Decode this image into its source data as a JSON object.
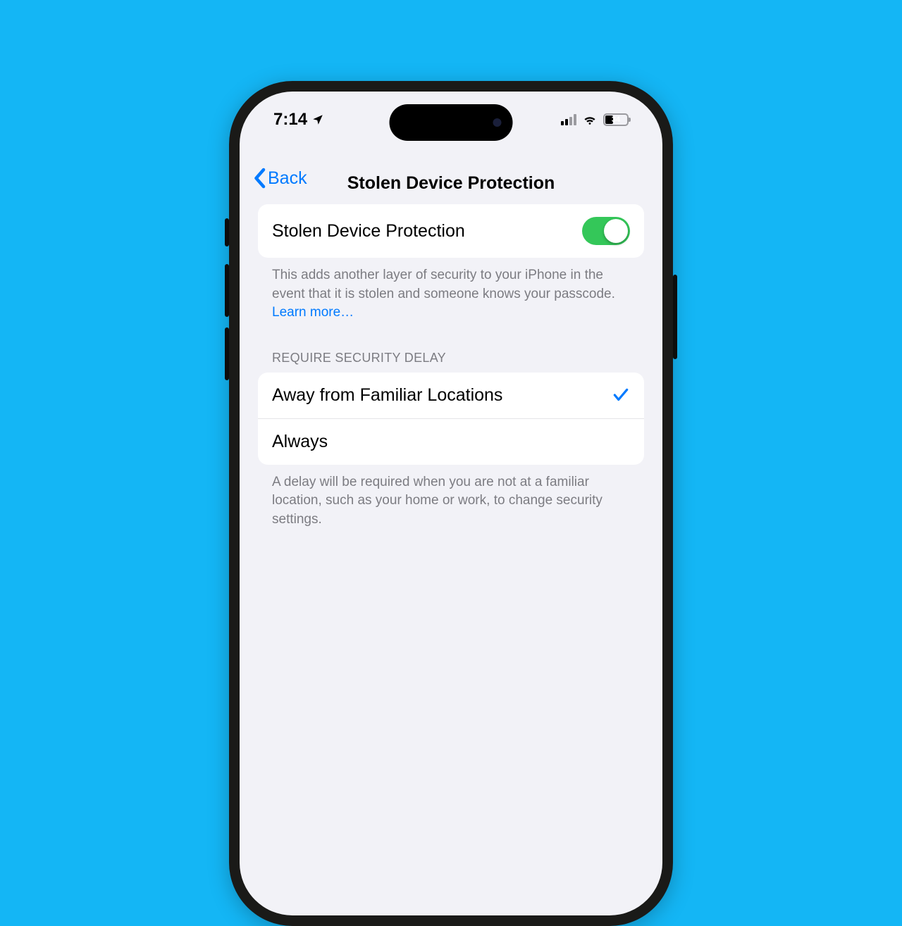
{
  "status": {
    "time": "7:14",
    "battery_pct": "34"
  },
  "nav": {
    "back_label": "Back",
    "title": "Stolen Device Protection"
  },
  "main_toggle": {
    "label": "Stolen Device Protection",
    "enabled": true
  },
  "main_footer": {
    "text": "This adds another layer of security to your iPhone in the event that it is stolen and someone knows your passcode. ",
    "link": "Learn more…"
  },
  "delay_section": {
    "header": "REQUIRE SECURITY DELAY",
    "options": [
      {
        "label": "Away from Familiar Locations",
        "selected": true
      },
      {
        "label": "Always",
        "selected": false
      }
    ],
    "footer": "A delay will be required when you are not at a familiar location, such as your home or work, to change security settings."
  }
}
